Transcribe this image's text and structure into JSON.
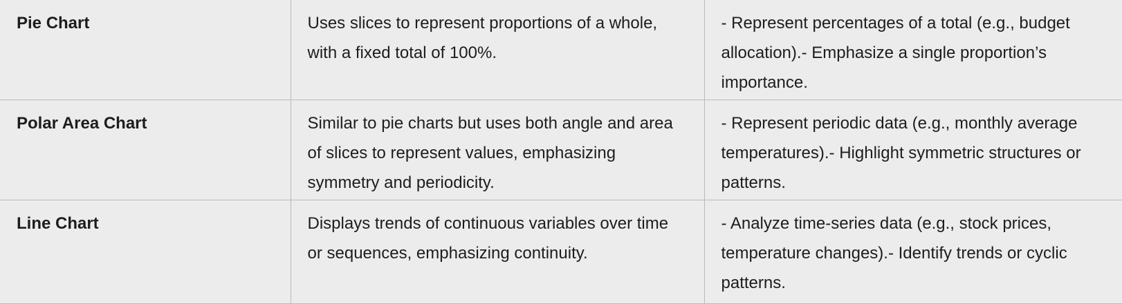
{
  "rows": [
    {
      "name": "Pie Chart",
      "description": "Uses slices to represent proportions of a whole, with a fixed total of 100%.",
      "use_cases": "- Represent percentages of a total (e.g., budget allocation).- Emphasize a single proportion’s importance."
    },
    {
      "name": "Polar Area Chart",
      "description": "Similar to pie charts but uses both angle and area of slices to represent values, emphasizing symmetry and periodicity.",
      "use_cases": "- Represent periodic data (e.g., monthly average temperatures).- Highlight symmetric structures or patterns."
    },
    {
      "name": "Line Chart",
      "description": "Displays trends of continuous variables over time or sequences, emphasizing continuity.",
      "use_cases": "- Analyze time-series data (e.g., stock prices, temperature changes).- Identify trends or cyclic patterns."
    }
  ]
}
